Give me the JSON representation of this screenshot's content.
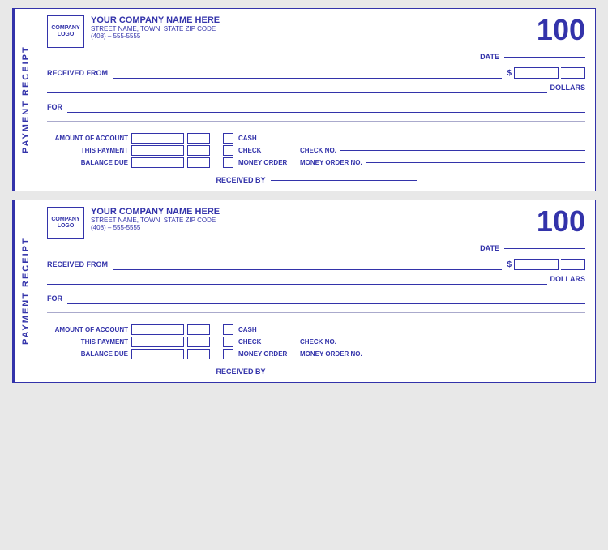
{
  "receipts": [
    {
      "sidebar_label": "PAYMENT RECEIPT",
      "receipt_number": "100",
      "company": {
        "logo_line1": "COMPANY",
        "logo_line2": "LOGO",
        "name": "YOUR COMPANY NAME HERE",
        "address": "STREET NAME, TOWN, STATE  ZIP CODE",
        "phone": "(408) – 555-5555"
      },
      "date_label": "DATE",
      "received_from_label": "RECEIVED FROM",
      "dollar_sign": "$",
      "dollars_label": "DOLLARS",
      "for_label": "FOR",
      "table": {
        "amount_label": "AMOUNT OF ACCOUNT",
        "payment_label": "THIS PAYMENT",
        "balance_label": "BALANCE DUE"
      },
      "payment_methods": [
        {
          "label": "CASH"
        },
        {
          "label": "CHECK",
          "extra_label": "CHECK NO."
        },
        {
          "label": "MONEY ORDER",
          "extra_label": "MONEY ORDER NO."
        }
      ],
      "received_by_label": "RECEIVED BY"
    },
    {
      "sidebar_label": "PAYMENT RECEIPT",
      "receipt_number": "100",
      "company": {
        "logo_line1": "COMPANY",
        "logo_line2": "LOGO",
        "name": "YOUR COMPANY NAME HERE",
        "address": "STREET NAME, TOWN, STATE  ZIP CODE",
        "phone": "(408) – 555-5555"
      },
      "date_label": "DATE",
      "received_from_label": "RECEIVED FROM",
      "dollar_sign": "$",
      "dollars_label": "DOLLARS",
      "for_label": "FOR",
      "table": {
        "amount_label": "AMOUNT OF ACCOUNT",
        "payment_label": "THIS PAYMENT",
        "balance_label": "BALANCE DUE"
      },
      "payment_methods": [
        {
          "label": "CASH"
        },
        {
          "label": "CHECK",
          "extra_label": "CHECK NO."
        },
        {
          "label": "MONEY ORDER",
          "extra_label": "MONEY ORDER NO."
        }
      ],
      "received_by_label": "RECEIVED BY"
    }
  ]
}
